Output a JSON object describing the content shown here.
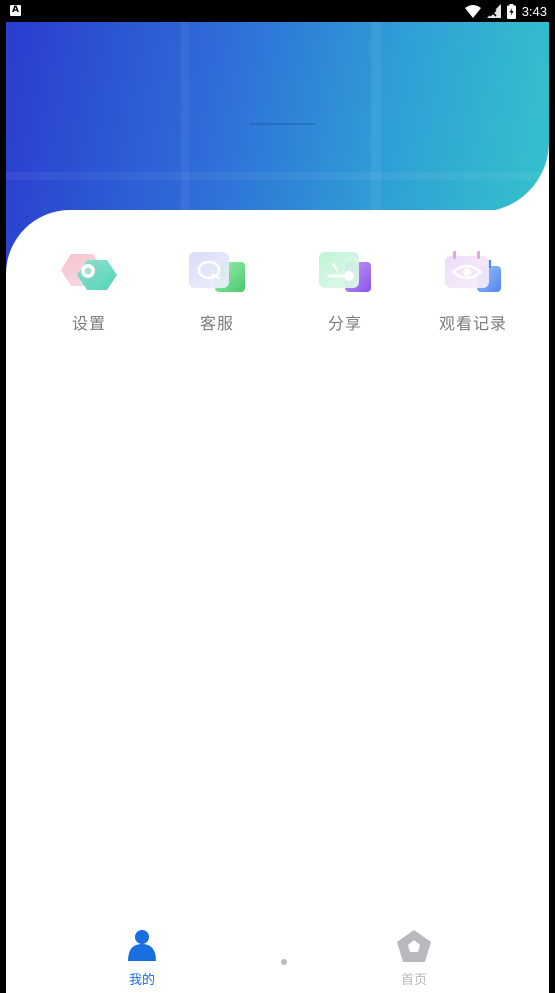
{
  "status_bar": {
    "time": "3:43",
    "app_badge": "A"
  },
  "menu": [
    {
      "label": "设置",
      "icon": "settings-icon"
    },
    {
      "label": "客服",
      "icon": "customer-service-icon"
    },
    {
      "label": "分享",
      "icon": "share-icon"
    },
    {
      "label": "观看记录",
      "icon": "watch-history-icon"
    }
  ],
  "bottom_nav": [
    {
      "label": "我的",
      "icon": "user-icon",
      "active": true,
      "color": "#1a6fe0"
    },
    {
      "label": "首页",
      "icon": "home-icon",
      "active": false,
      "color": "#b9b9bd"
    }
  ],
  "colors": {
    "accent": "#1a6fe0",
    "hero_start": "#2a3ccf",
    "hero_end": "#35c2cb"
  }
}
